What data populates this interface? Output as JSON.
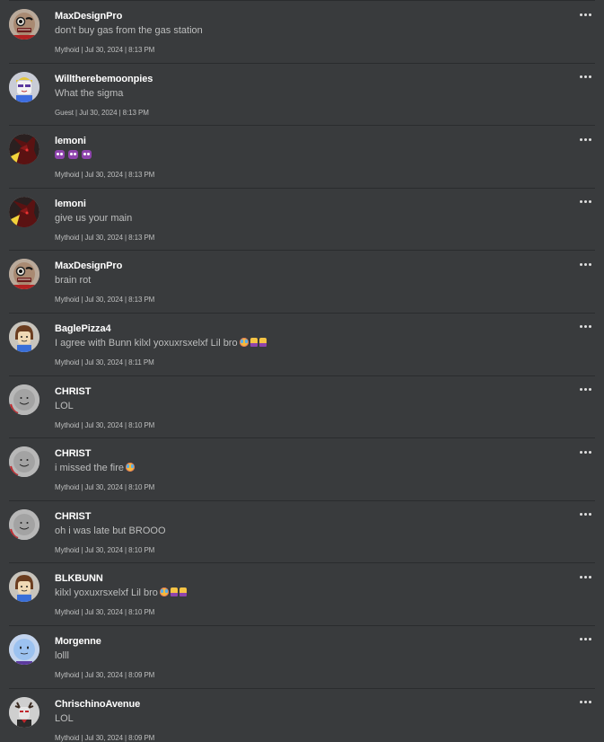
{
  "colors": {
    "background": "#393b3d",
    "divider": "#2a2c2e",
    "username": "#ffffff",
    "text": "#bdbebe"
  },
  "comments": [
    {
      "username": "MaxDesignPro",
      "text": "don't buy gas from the gas station",
      "meta": "Mythoid | Jul 30, 2024 | 8:13 PM",
      "avatar": "max-avatar",
      "emojis": []
    },
    {
      "username": "Willtherebemoonpies",
      "text": "What the sigma",
      "meta": "Guest | Jul 30, 2024 | 8:13 PM",
      "avatar": "will-avatar",
      "emojis": []
    },
    {
      "username": "lemoni",
      "text": "",
      "meta": "Mythoid | Jul 30, 2024 | 8:13 PM",
      "avatar": "lemoni-avatar",
      "emojis": [
        "face-emoji",
        "face-emoji",
        "face-emoji"
      ]
    },
    {
      "username": "lemoni",
      "text": "give us your main",
      "meta": "Mythoid | Jul 30, 2024 | 8:13 PM",
      "avatar": "lemoni-avatar",
      "emojis": []
    },
    {
      "username": "MaxDesignPro",
      "text": "brain rot",
      "meta": "Mythoid | Jul 30, 2024 | 8:13 PM",
      "avatar": "max-avatar",
      "emojis": []
    },
    {
      "username": "BaglePizza4",
      "text": "I agree with Bunn kilxl yoxuxrsxelxf Lil bro",
      "meta": "Mythoid | Jul 30, 2024 | 8:11 PM",
      "avatar": "noob-avatar",
      "emojis": [
        "crying-emoji",
        "praying-emoji",
        "praying-emoji"
      ]
    },
    {
      "username": "CHRIST",
      "text": "LOL",
      "meta": "Mythoid | Jul 30, 2024 | 8:10 PM",
      "avatar": "christ-avatar",
      "emojis": []
    },
    {
      "username": "CHRIST",
      "text": "i missed the fire",
      "meta": "Mythoid | Jul 30, 2024 | 8:10 PM",
      "avatar": "christ-avatar",
      "emojis": [
        "crying-emoji"
      ]
    },
    {
      "username": "CHRIST",
      "text": "oh i was late but BROOO",
      "meta": "Mythoid | Jul 30, 2024 | 8:10 PM",
      "avatar": "christ-avatar",
      "emojis": []
    },
    {
      "username": "BLKBUNN",
      "text": "kilxl yoxuxrsxelxf Lil bro",
      "meta": "Mythoid | Jul 30, 2024 | 8:10 PM",
      "avatar": "noob-avatar",
      "emojis": [
        "crying-emoji",
        "praying-emoji",
        "praying-emoji"
      ]
    },
    {
      "username": "Morgenne",
      "text": "lolll",
      "meta": "Mythoid | Jul 30, 2024 | 8:09 PM",
      "avatar": "morgenne-avatar",
      "emojis": []
    },
    {
      "username": "ChrischinoAvenue",
      "text": "LOL",
      "meta": "Mythoid | Jul 30, 2024 | 8:09 PM",
      "avatar": "chrischino-avatar",
      "emojis": []
    }
  ]
}
